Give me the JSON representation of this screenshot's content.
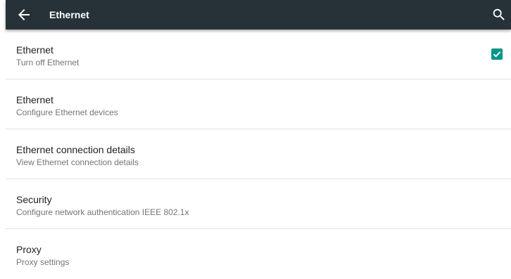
{
  "appbar": {
    "title": "Ethernet",
    "back_icon": "arrow-back-icon",
    "search_icon": "search-icon",
    "background": "#263238"
  },
  "items": [
    {
      "label": "Ethernet",
      "summary": "Turn off Ethernet",
      "checked": true
    },
    {
      "label": "Ethernet",
      "summary": "Configure Ethernet devices"
    },
    {
      "label": "Ethernet connection details",
      "summary": "View Ethernet connection details"
    },
    {
      "label": "Security",
      "summary": "Configure network authentication IEEE 802.1x"
    },
    {
      "label": "Proxy",
      "summary": "Proxy settings"
    }
  ],
  "colors": {
    "accent": "#009688",
    "primary_text": "#212121",
    "secondary_text": "#757575",
    "divider": "#e3e3e3"
  }
}
